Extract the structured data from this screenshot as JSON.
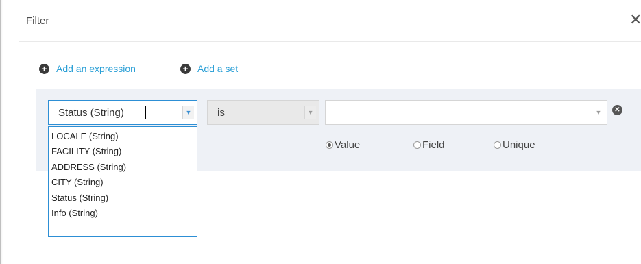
{
  "dialog": {
    "title": "Filter",
    "close_glyph": "✕"
  },
  "actions": {
    "add_expression_label": "Add an expression",
    "add_set_label": "Add a set"
  },
  "expression": {
    "field_value": "Status (String)",
    "operator_value": "is",
    "value_text": "",
    "radio_options": [
      {
        "label": "Value",
        "checked": true
      },
      {
        "label": "Field",
        "checked": false
      },
      {
        "label": "Unique",
        "checked": false
      }
    ],
    "field_options": [
      "LOCALE (String)",
      "FACILITY (String)",
      "ADDRESS (String)",
      "CITY (String)",
      "Status (String)",
      "Info (String)"
    ]
  },
  "icons": {
    "plus": "+",
    "remove": "✕",
    "dropdown_arrow": "▼"
  },
  "colors": {
    "link": "#2a9fd6",
    "focus_border": "#2d8fd5",
    "panel_background": "#eef1f6"
  }
}
